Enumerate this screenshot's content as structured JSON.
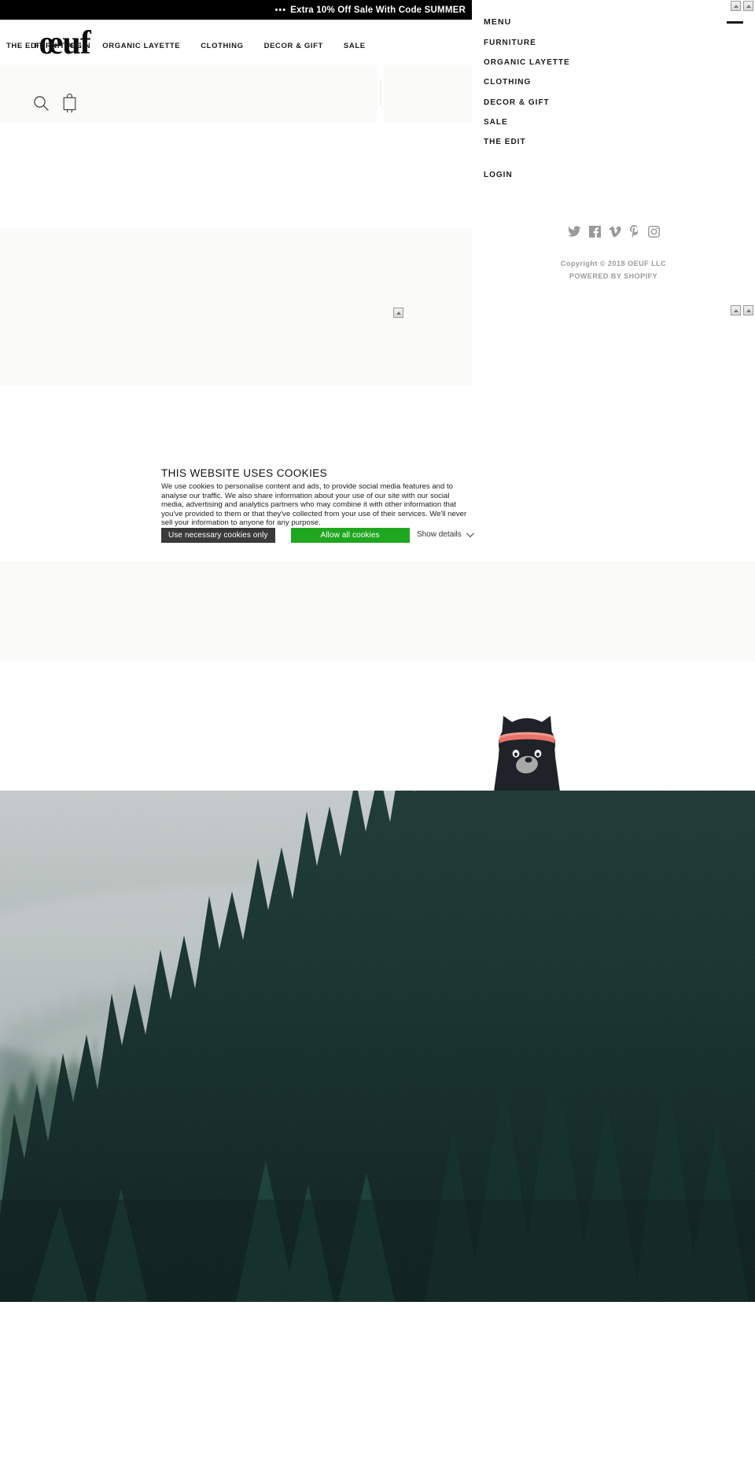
{
  "announcement": {
    "dots": "•••",
    "text": "Extra 10% Off Sale With Code SUMMER"
  },
  "brand": {
    "logo": "œuf"
  },
  "storefront_nav": {
    "primary": [
      {
        "label": "FURNITURE"
      },
      {
        "label": "ORGANIC LAYETTE"
      },
      {
        "label": "CLOTHING"
      },
      {
        "label": "DECOR & GIFT"
      },
      {
        "label": "SALE"
      }
    ],
    "secondary": [
      {
        "label": "THE EDIT"
      },
      {
        "label": "LOGIN"
      }
    ],
    "icons": [
      {
        "name": "search-icon"
      },
      {
        "name": "cart-icon"
      }
    ]
  },
  "drawer": {
    "title": "MENU",
    "close_label": "Close menu",
    "items": [
      {
        "label": "FURNITURE"
      },
      {
        "label": "ORGANIC LAYETTE"
      },
      {
        "label": "CLOTHING"
      },
      {
        "label": "DECOR & GIFT"
      },
      {
        "label": "SALE"
      },
      {
        "label": "THE EDIT"
      }
    ],
    "login": {
      "label": "LOGIN"
    },
    "social": [
      {
        "name": "twitter-icon"
      },
      {
        "name": "facebook-icon"
      },
      {
        "name": "vimeo-icon"
      },
      {
        "name": "pinterest-icon"
      },
      {
        "name": "instagram-icon"
      }
    ],
    "copyright": "Copyright © 2018 OEUF LLC",
    "powered_by": "POWERED BY SHOPIFY"
  },
  "cookie_banner": {
    "title": "THIS WEBSITE USES COOKIES",
    "body": "We use cookies to personalise content and ads, to provide social media features and to analyse our traffic. We also share information about your use of our site with our social media, advertising and analytics partners who may combine it with other information that you've provided to them or that they've collected from your use of their services.  We'll never sell your information to anyone for any purpose.",
    "necessary_label": "Use necessary cookies only",
    "allow_label": "Allow all cookies",
    "show_details_label": "Show details"
  },
  "colors": {
    "announcement_bg": "#000000",
    "nav_bg": "#fafaf8",
    "allow_button": "#1fa71f",
    "necessary_button": "#3a3a3a",
    "text": "#1a1a1a",
    "muted": "#9a9a9a",
    "bear_body": "#1f2329",
    "bear_headband": "#e8736a",
    "bear_snout": "#a8a8a8"
  },
  "media": {
    "bear_alt": "black bear wearing red headband",
    "hero_alt": "misty evergreen forest landscape"
  }
}
